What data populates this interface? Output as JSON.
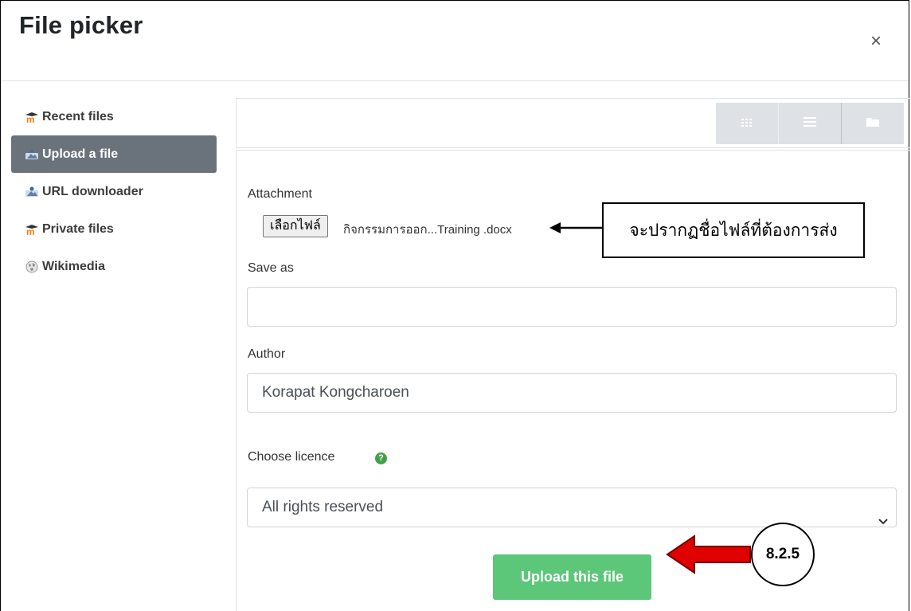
{
  "dialog": {
    "title": "File picker",
    "close_glyph": "×"
  },
  "sidebar": {
    "items": [
      {
        "label": "Recent files",
        "icon": "moodle-icon",
        "active": false
      },
      {
        "label": "Upload a file",
        "icon": "upload-icon",
        "active": true
      },
      {
        "label": "URL downloader",
        "icon": "url-download-icon",
        "active": false
      },
      {
        "label": "Private files",
        "icon": "moodle-icon",
        "active": false
      },
      {
        "label": "Wikimedia",
        "icon": "wikimedia-icon",
        "active": false
      }
    ]
  },
  "toolbar": {
    "views": [
      "grid-view-icon",
      "list-view-icon",
      "folder-view-icon"
    ]
  },
  "form": {
    "attachment_label": "Attachment",
    "file_button_label": "เลือกไฟล์",
    "file_name": "กิจกรรมการออก...Training .docx",
    "save_as_label": "Save as",
    "save_as_value": "",
    "author_label": "Author",
    "author_value": "Korapat Kongcharoen",
    "licence_label": "Choose licence",
    "help_glyph": "?",
    "licence_value": "All rights reserved",
    "upload_button_label": "Upload this file"
  },
  "annotations": {
    "callout_text": "จะปรากฏชื่อไฟล์ที่ต้องการส่ง",
    "step_label": "8.2.5"
  },
  "colors": {
    "active_sidebar": "#6a737b",
    "upload_button": "#5cc679",
    "help_icon": "#43a047",
    "arrow_red": "#e00000",
    "moodle_orange": "#f98012"
  }
}
